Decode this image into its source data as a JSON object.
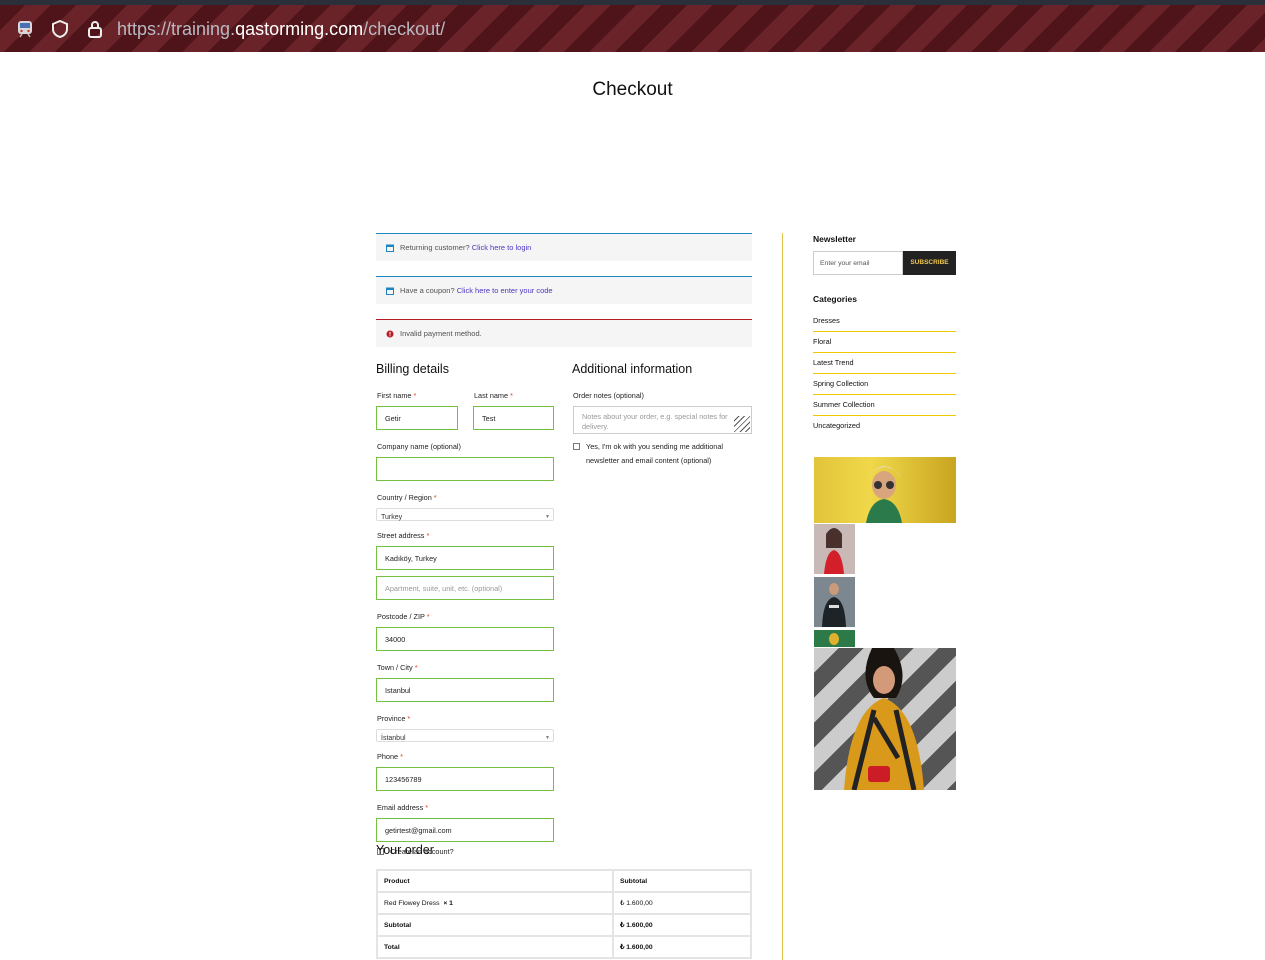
{
  "browser": {
    "url_prefix": "https://training.",
    "url_domain": "qastorming.com",
    "url_path": "/checkout/",
    "icons": [
      "train-icon",
      "shield-icon",
      "lock-icon"
    ]
  },
  "page": {
    "title": "Checkout"
  },
  "notices": {
    "returning": {
      "text": "Returning customer?",
      "link": "Click here to login"
    },
    "coupon": {
      "text": "Have a coupon?",
      "link": "Click here to enter your code"
    },
    "error": {
      "text": "Invalid payment method."
    }
  },
  "billing": {
    "heading": "Billing details",
    "first_name": {
      "label": "First name",
      "required": "*",
      "value": "Getir"
    },
    "last_name": {
      "label": "Last name",
      "required": "*",
      "value": "Test"
    },
    "company": {
      "label": "Company name (optional)",
      "value": ""
    },
    "country": {
      "label": "Country / Region",
      "required": "*",
      "value": "Turkey"
    },
    "street": {
      "label": "Street address",
      "required": "*",
      "value": "Kadıköy, Turkey",
      "placeholder2": "Apartment, suite, unit, etc. (optional)"
    },
    "postcode": {
      "label": "Postcode / ZIP",
      "required": "*",
      "value": "34000"
    },
    "city": {
      "label": "Town / City",
      "required": "*",
      "value": "Istanbul"
    },
    "province": {
      "label": "Province",
      "required": "*",
      "value": "İstanbul"
    },
    "phone": {
      "label": "Phone",
      "required": "*",
      "value": "123456789"
    },
    "email": {
      "label": "Email address",
      "required": "*",
      "value": "getirtest@gmail.com"
    },
    "create_account": "Create an account?"
  },
  "additional": {
    "heading": "Additional information",
    "notes_label": "Order notes (optional)",
    "notes_placeholder": "Notes about your order, e.g. special notes for delivery.",
    "newsletter_optin": "Yes, I'm ok with you sending me additional newsletter and email content (optional)"
  },
  "order": {
    "heading": "Your order",
    "col_product": "Product",
    "col_subtotal": "Subtotal",
    "item_name": "Red Flowey Dress",
    "item_qty": "× 1",
    "item_price": "₺ 1.600,00",
    "subtotal_label": "Subtotal",
    "subtotal_value": "₺ 1.600,00",
    "total_label": "Total",
    "total_value": "₺ 1.600,00"
  },
  "sidebar": {
    "newsletter_heading": "Newsletter",
    "email_placeholder": "Enter your email",
    "subscribe_label": "SUBSCRIBE",
    "categories_heading": "Categories",
    "categories": [
      "Dresses",
      "Floral",
      "Latest Trend",
      "Spring Collection",
      "Summer Collection",
      "Uncategorized"
    ]
  },
  "colors": {
    "accent_green": "#74c043",
    "divider_gold": "#e6c64a",
    "link": "#4b37c4",
    "error": "#b81c23"
  }
}
